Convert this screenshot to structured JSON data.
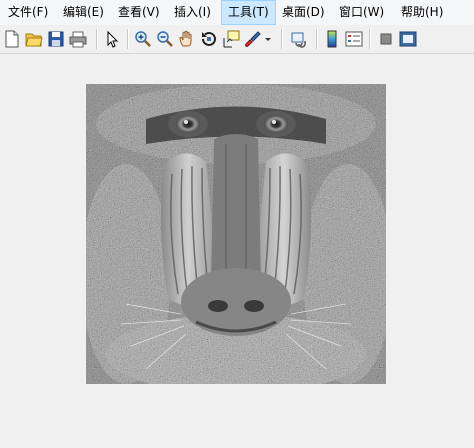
{
  "menubar": {
    "items": [
      {
        "label": "文件(F)",
        "active": false
      },
      {
        "label": "编辑(E)",
        "active": false
      },
      {
        "label": "查看(V)",
        "active": false
      },
      {
        "label": "插入(I)",
        "active": false
      },
      {
        "label": "工具(T)",
        "active": true
      },
      {
        "label": "桌面(D)",
        "active": false
      },
      {
        "label": "窗口(W)",
        "active": false
      },
      {
        "label": "帮助(H)",
        "active": false
      }
    ]
  },
  "toolbar": {
    "buttons": [
      "new-figure-icon",
      "open-file-icon",
      "save-figure-icon",
      "print-figure-icon",
      "edit-plot-icon",
      "zoom-in-icon",
      "zoom-out-icon",
      "pan-icon",
      "rotate-3d-icon",
      "data-cursor-icon",
      "brush-icon",
      "brush-dropdown-icon",
      "link-plot-icon",
      "colorbar-icon",
      "legend-icon",
      "hide-plot-tools-icon",
      "show-plot-tools-icon"
    ]
  },
  "figure": {
    "image_description": "grayscale mandrill (baboon) face"
  },
  "colors": {
    "menubar_bg": "#f5f6f7",
    "menu_active_bg": "#cce8ff",
    "menu_active_border": "#99d1ff",
    "window_bg": "#f0f0f0"
  }
}
